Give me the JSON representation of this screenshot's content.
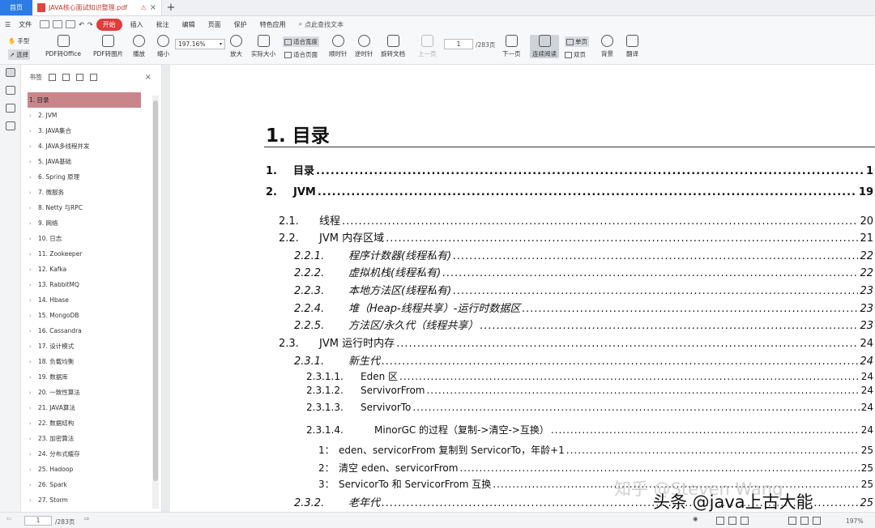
{
  "tabs": {
    "home": "首页",
    "doc": "JAVA核心面试知识整理.pdf",
    "add": "+"
  },
  "menu": {
    "file": "文件",
    "start": "开始",
    "items": [
      "插入",
      "批注",
      "编辑",
      "页面",
      "保护",
      "特色应用"
    ],
    "search": "点此查找文本"
  },
  "toolbar": {
    "hand": "手型",
    "select": "选择",
    "pdf_office": "PDF转Office",
    "pdf_img": "PDF转图片",
    "play": "播放",
    "shrink": "缩小",
    "zoom": "197.16%",
    "enlarge": "放大",
    "actual": "实际大小",
    "fit_width": "适合宽度",
    "fit_page": "适合页面",
    "rotate_cw": "顺时针",
    "rotate_ccw": "逆时针",
    "rotate_doc": "旋转文档",
    "prev": "上一页",
    "page": "1",
    "total": "/283页",
    "next": "下一页",
    "continuous": "连续阅读",
    "single": "单页",
    "double": "双页",
    "bg": "背景",
    "translate": "翻译"
  },
  "bookmarks": {
    "title": "书签",
    "items": [
      "1. 目录",
      "2. JVM",
      "3. JAVA集合",
      "4. JAVA多线程并发",
      "5. JAVA基础",
      "6. Spring 原理",
      "7.   微服务",
      "8. Netty 与RPC",
      "9. 网络",
      "10. 日志",
      "11. Zookeeper",
      "12. Kafka",
      "13. RabbitMQ",
      "14. Hbase",
      "15. MongoDB",
      "16. Cassandra",
      "17. 设计模式",
      "18. 负载均衡",
      "19. 数据库",
      "20. 一致性算法",
      "21. JAVA算法",
      "22. 数据结构",
      "23. 加密算法",
      "24. 分布式缓存",
      "25. Hadoop",
      "26. Spark",
      "27. Storm"
    ]
  },
  "page": {
    "heading": "1. 目录",
    "toc": [
      {
        "num": "1.",
        "label": "目录",
        "page": "1"
      },
      {
        "num": "2.",
        "label": "JVM",
        "page": "19"
      },
      {
        "num": "2.1.",
        "label": "线程",
        "page": "20"
      },
      {
        "num": "2.2.",
        "label": "JVM 内存区域",
        "page": "21"
      },
      {
        "num": "2.2.1.",
        "label": "程序计数器(线程私有)",
        "page": "22"
      },
      {
        "num": "2.2.2.",
        "label": "虚拟机栈(线程私有)",
        "page": "22"
      },
      {
        "num": "2.2.3.",
        "label": "本地方法区(线程私有)",
        "page": "23"
      },
      {
        "num": "2.2.4.",
        "label": "堆（Heap-线程共享）-运行时数据区",
        "page": "23"
      },
      {
        "num": "2.2.5.",
        "label": "方法区/永久代（线程共享）",
        "page": "23"
      },
      {
        "num": "2.3.",
        "label": "JVM 运行时内存",
        "page": "24"
      },
      {
        "num": "2.3.1.",
        "label": "新生代",
        "page": "24"
      },
      {
        "num": "2.3.1.1.",
        "label": "Eden 区",
        "page": "24"
      },
      {
        "num": "2.3.1.2.",
        "label": "ServivorFrom",
        "page": "24"
      },
      {
        "num": "2.3.1.3.",
        "label": "ServivorTo",
        "page": "24"
      },
      {
        "num": "2.3.1.4.",
        "label": "MinorGC 的过程（复制->清空->互换）",
        "page": "24"
      },
      {
        "num": "1：",
        "label": "eden、servicorFrom 复制到 ServicorTo，年龄+1",
        "page": "25"
      },
      {
        "num": "2：",
        "label": "清空 eden、servicorFrom",
        "page": "25"
      },
      {
        "num": "3：",
        "label": "ServicorTo 和 ServicorFrom 互换",
        "page": "25"
      },
      {
        "num": "2.3.2.",
        "label": "老年代",
        "page": "25"
      }
    ]
  },
  "statusbar": {
    "page": "1",
    "total": "/283页",
    "zoom": "197%"
  },
  "watermark": {
    "zhihu": "知乎 @Steven Wang",
    "toutiao": "头条 @java上古大能"
  }
}
